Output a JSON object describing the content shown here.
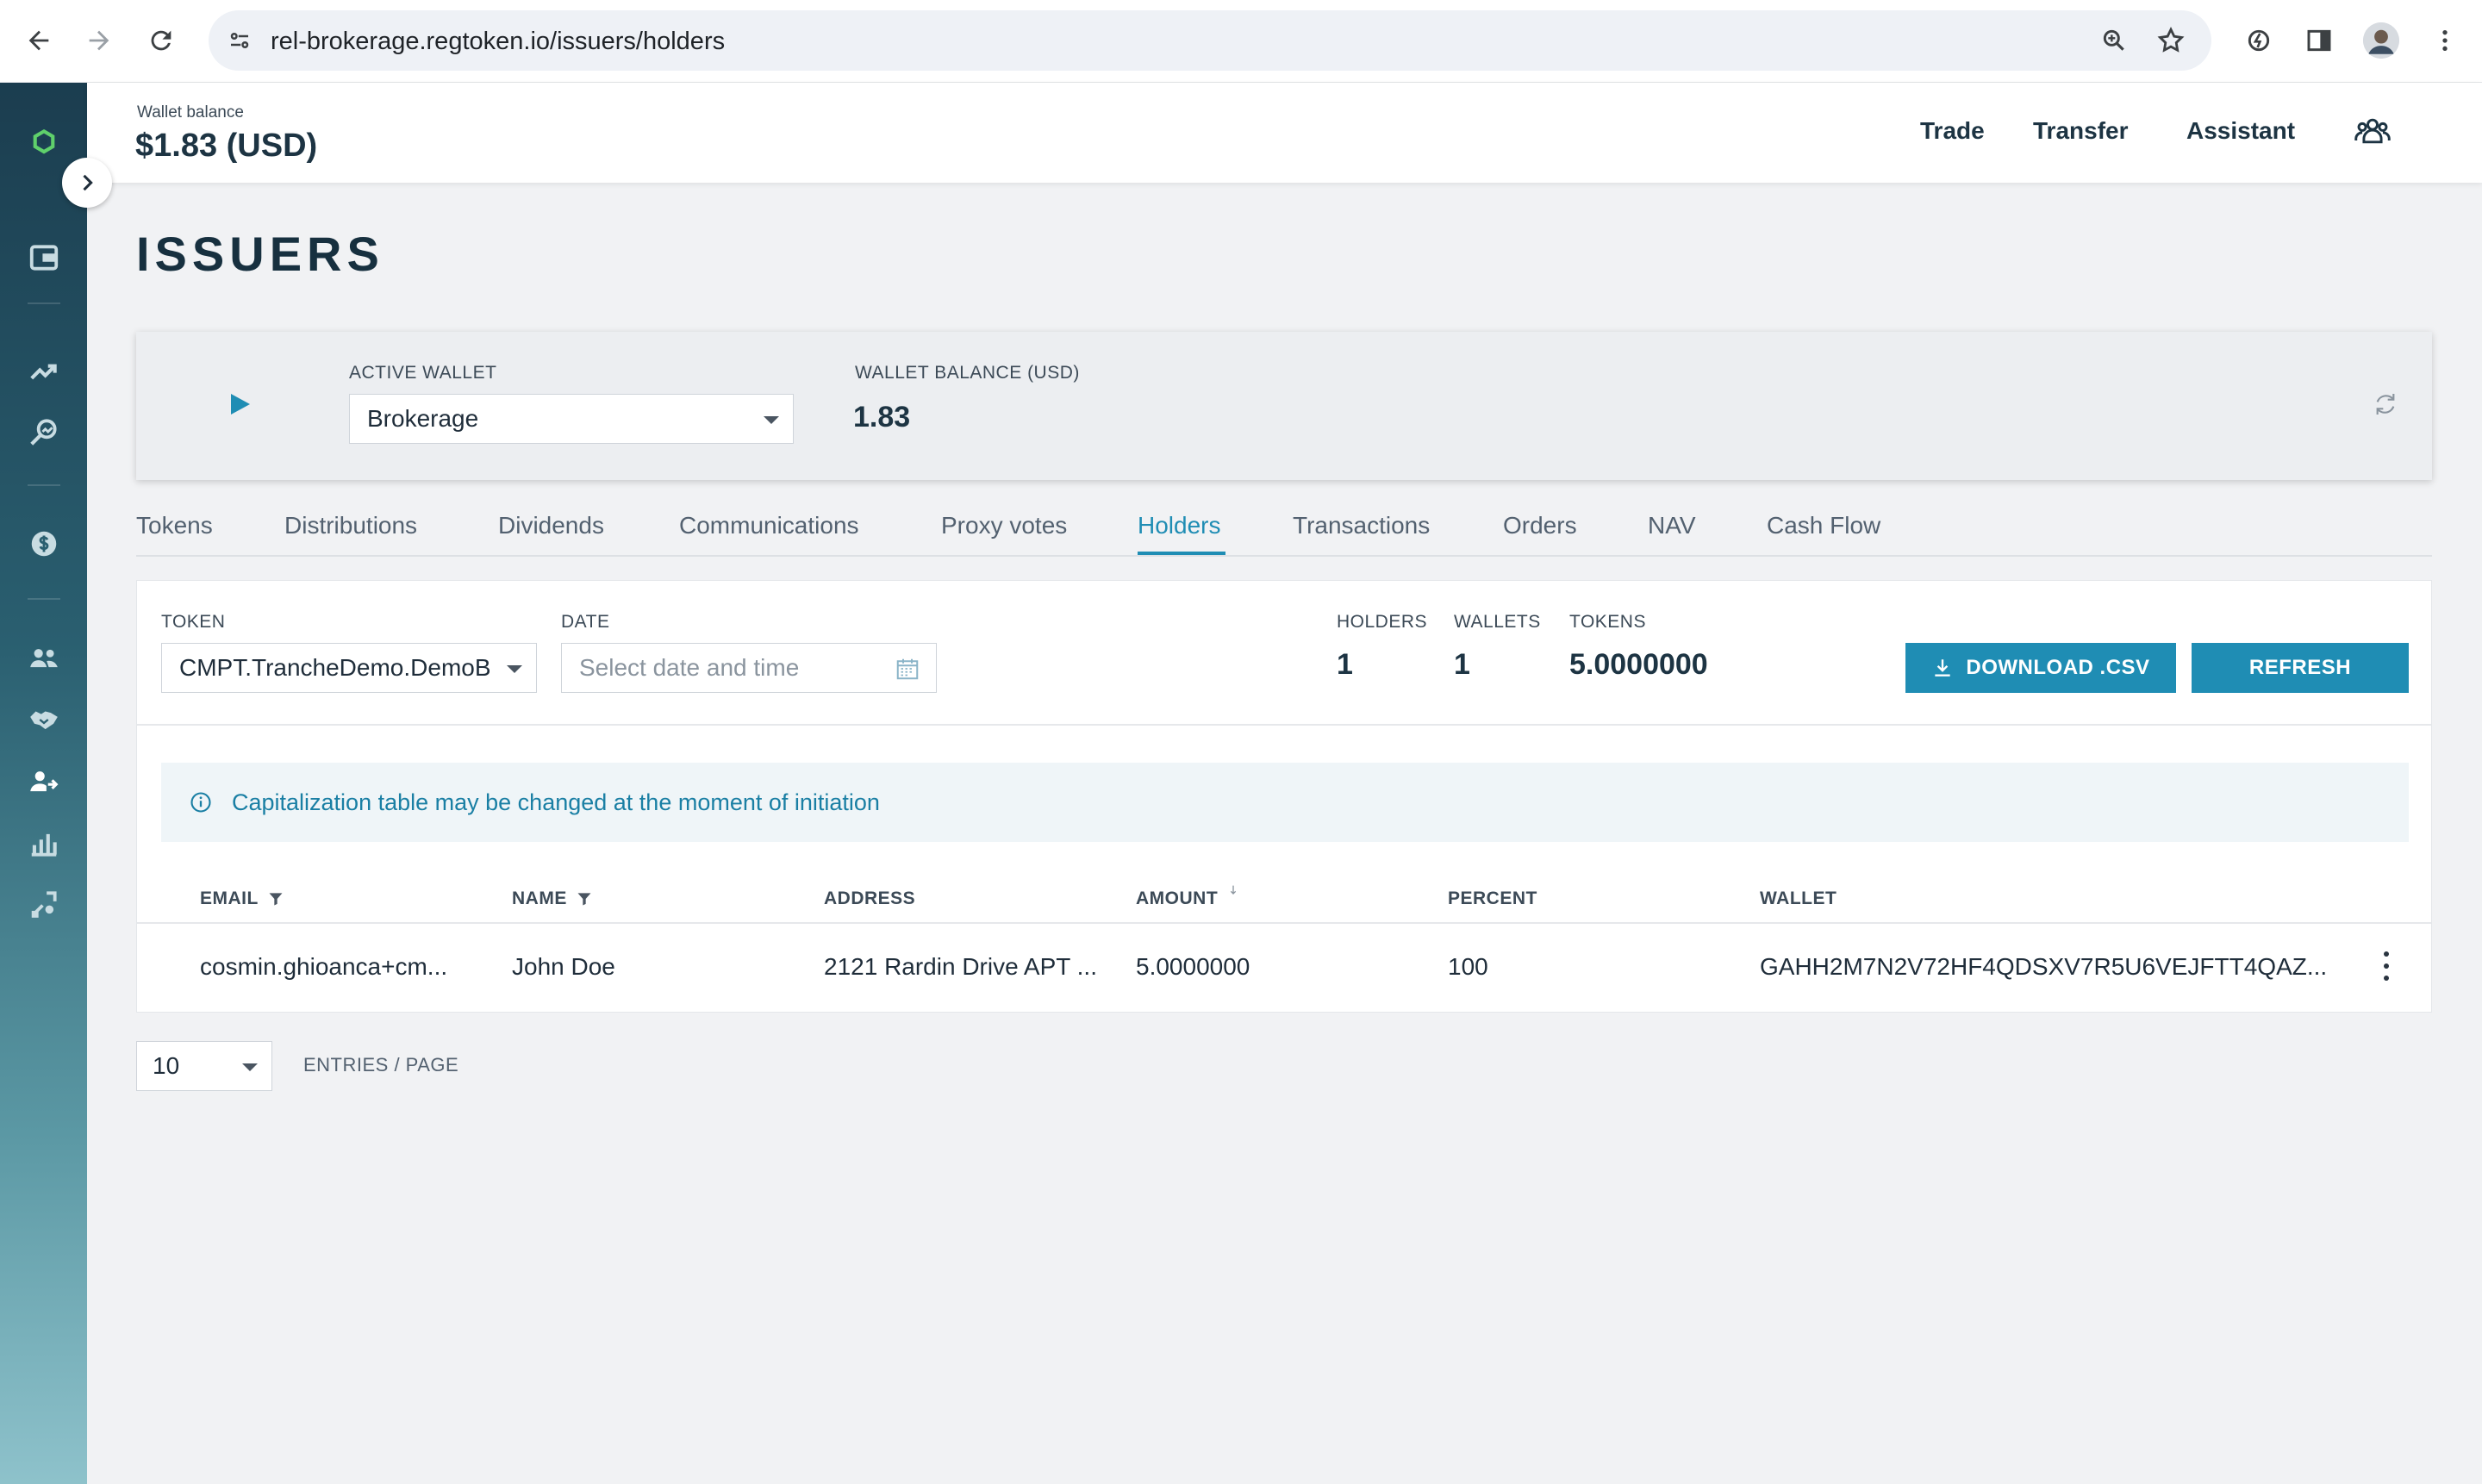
{
  "browser": {
    "url": "rel-brokerage.regtoken.io/issuers/holders"
  },
  "topbar": {
    "wallet_balance_label": "Wallet balance",
    "wallet_balance_value": "$1.83 (USD)",
    "nav": {
      "trade": "Trade",
      "transfer": "Transfer",
      "assistant": "Assistant"
    }
  },
  "page": {
    "title": "ISSUERS"
  },
  "wallet_card": {
    "active_wallet_label": "ACTIVE WALLET",
    "active_wallet_value": "Brokerage",
    "balance_label": "WALLET BALANCE (USD)",
    "balance_value": "1.83"
  },
  "tabs": [
    {
      "label": "Tokens"
    },
    {
      "label": "Distributions"
    },
    {
      "label": "Dividends"
    },
    {
      "label": "Communications"
    },
    {
      "label": "Proxy votes"
    },
    {
      "label": "Holders",
      "active": true
    },
    {
      "label": "Transactions"
    },
    {
      "label": "Orders"
    },
    {
      "label": "NAV"
    },
    {
      "label": "Cash Flow"
    }
  ],
  "holders": {
    "token_label": "TOKEN",
    "token_value": "CMPT.TrancheDemo.DemoBk",
    "date_label": "DATE",
    "date_placeholder": "Select date and time",
    "stats": {
      "holders_label": "HOLDERS",
      "holders_value": "1",
      "wallets_label": "WALLETS",
      "wallets_value": "1",
      "tokens_label": "TOKENS",
      "tokens_value": "5.0000000"
    },
    "download_label": "DOWNLOAD .CSV",
    "refresh_label": "REFRESH",
    "info_message": "Capitalization table may be changed at the moment of initiation",
    "columns": {
      "email": "EMAIL",
      "name": "NAME",
      "address": "ADDRESS",
      "amount": "AMOUNT",
      "percent": "PERCENT",
      "wallet": "WALLET"
    },
    "rows": [
      {
        "email": "cosmin.ghioanca+cm...",
        "name": "John Doe",
        "address": "2121 Rardin Drive APT ...",
        "amount": "5.0000000",
        "percent": "100",
        "wallet": "GAHH2M7N2V72HF4QDSXV7R5U6VEJFTT4QAZ..."
      }
    ]
  },
  "pagination": {
    "page_size": "10",
    "label": "ENTRIES / PAGE"
  },
  "colors": {
    "accent": "#1f8db4",
    "heading": "#1d3443",
    "sidebar_top": "#1b3d4f",
    "sidebar_bottom": "#8ec2cb"
  }
}
